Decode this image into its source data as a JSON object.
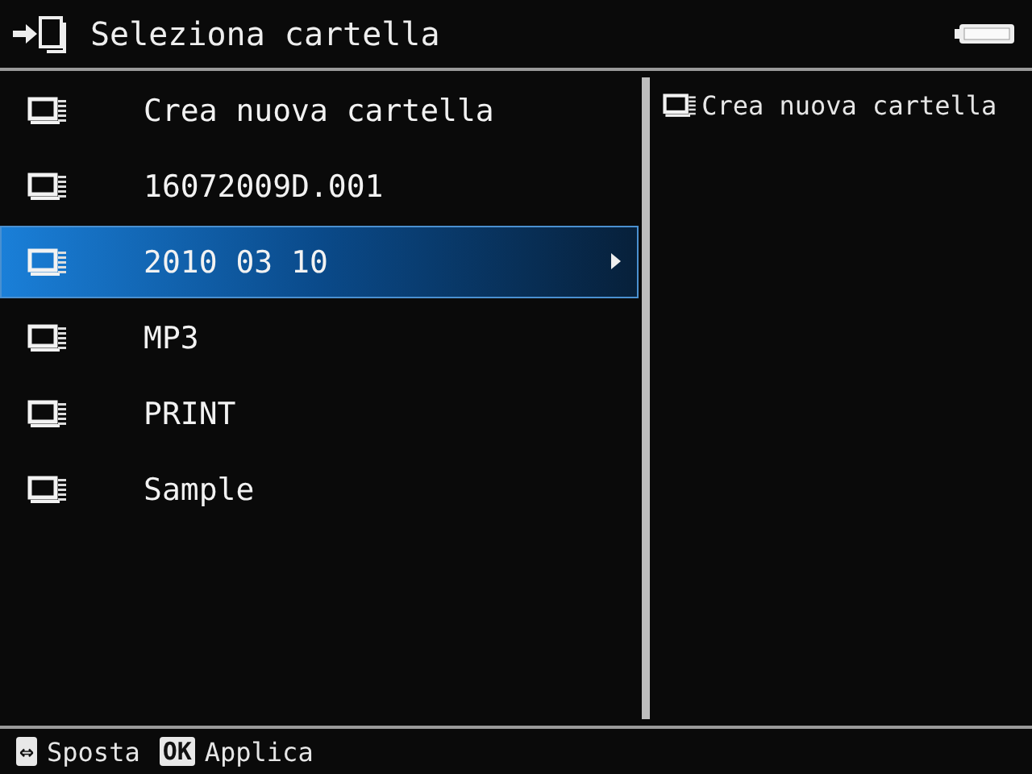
{
  "header": {
    "title": "Seleziona cartella"
  },
  "folders": [
    {
      "name": "Crea nuova cartella",
      "selected": false
    },
    {
      "name": "16072009D.001",
      "selected": false
    },
    {
      "name": "2010 03 10",
      "selected": true
    },
    {
      "name": "MP3",
      "selected": false
    },
    {
      "name": "PRINT",
      "selected": false
    },
    {
      "name": "Sample",
      "selected": false
    }
  ],
  "preview": {
    "items": [
      "Crea nuova cartella"
    ]
  },
  "footer": [
    {
      "key": "⇔",
      "label": "Sposta"
    },
    {
      "key": "OK",
      "label": "Applica"
    }
  ]
}
